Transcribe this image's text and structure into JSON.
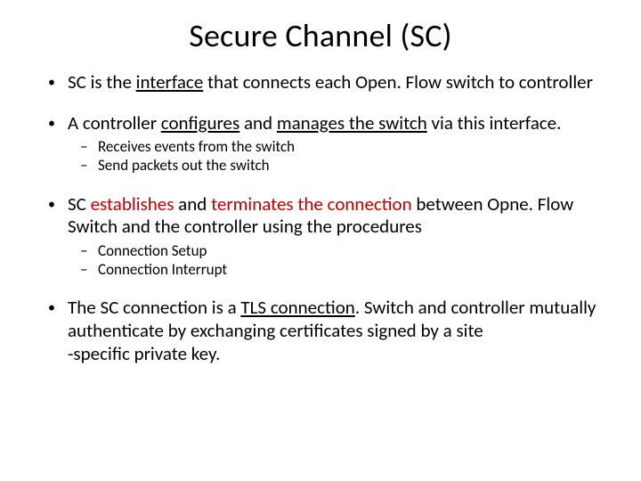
{
  "title": "Secure Channel (SC)",
  "b1": {
    "pre": "SC is the ",
    "u": "interface",
    "post": " that connects each Open. Flow switch to controller"
  },
  "b2": {
    "pre": "A controller ",
    "u1": "configures",
    "mid": " and ",
    "u2": "manages the switch",
    "post": " via this interface.",
    "s1": "Receives events from the switch",
    "s2": "Send packets out the switch"
  },
  "b3": {
    "pre": "SC ",
    "r1": "establishes",
    "mid1": " and ",
    "r2": "terminates",
    "mid2": " ",
    "r3": "the connection",
    "post": " between Opne. Flow Switch and the controller using the procedures",
    "s1": "Connection Setup",
    "s2": "Connection Interrupt"
  },
  "b4": {
    "pre": "The SC connection is a ",
    "u": "TLS  connection",
    "post1": ".  Switch and controller mutually authenticate by exchanging certificates signed by a site ",
    "post2": "-specific private key."
  }
}
